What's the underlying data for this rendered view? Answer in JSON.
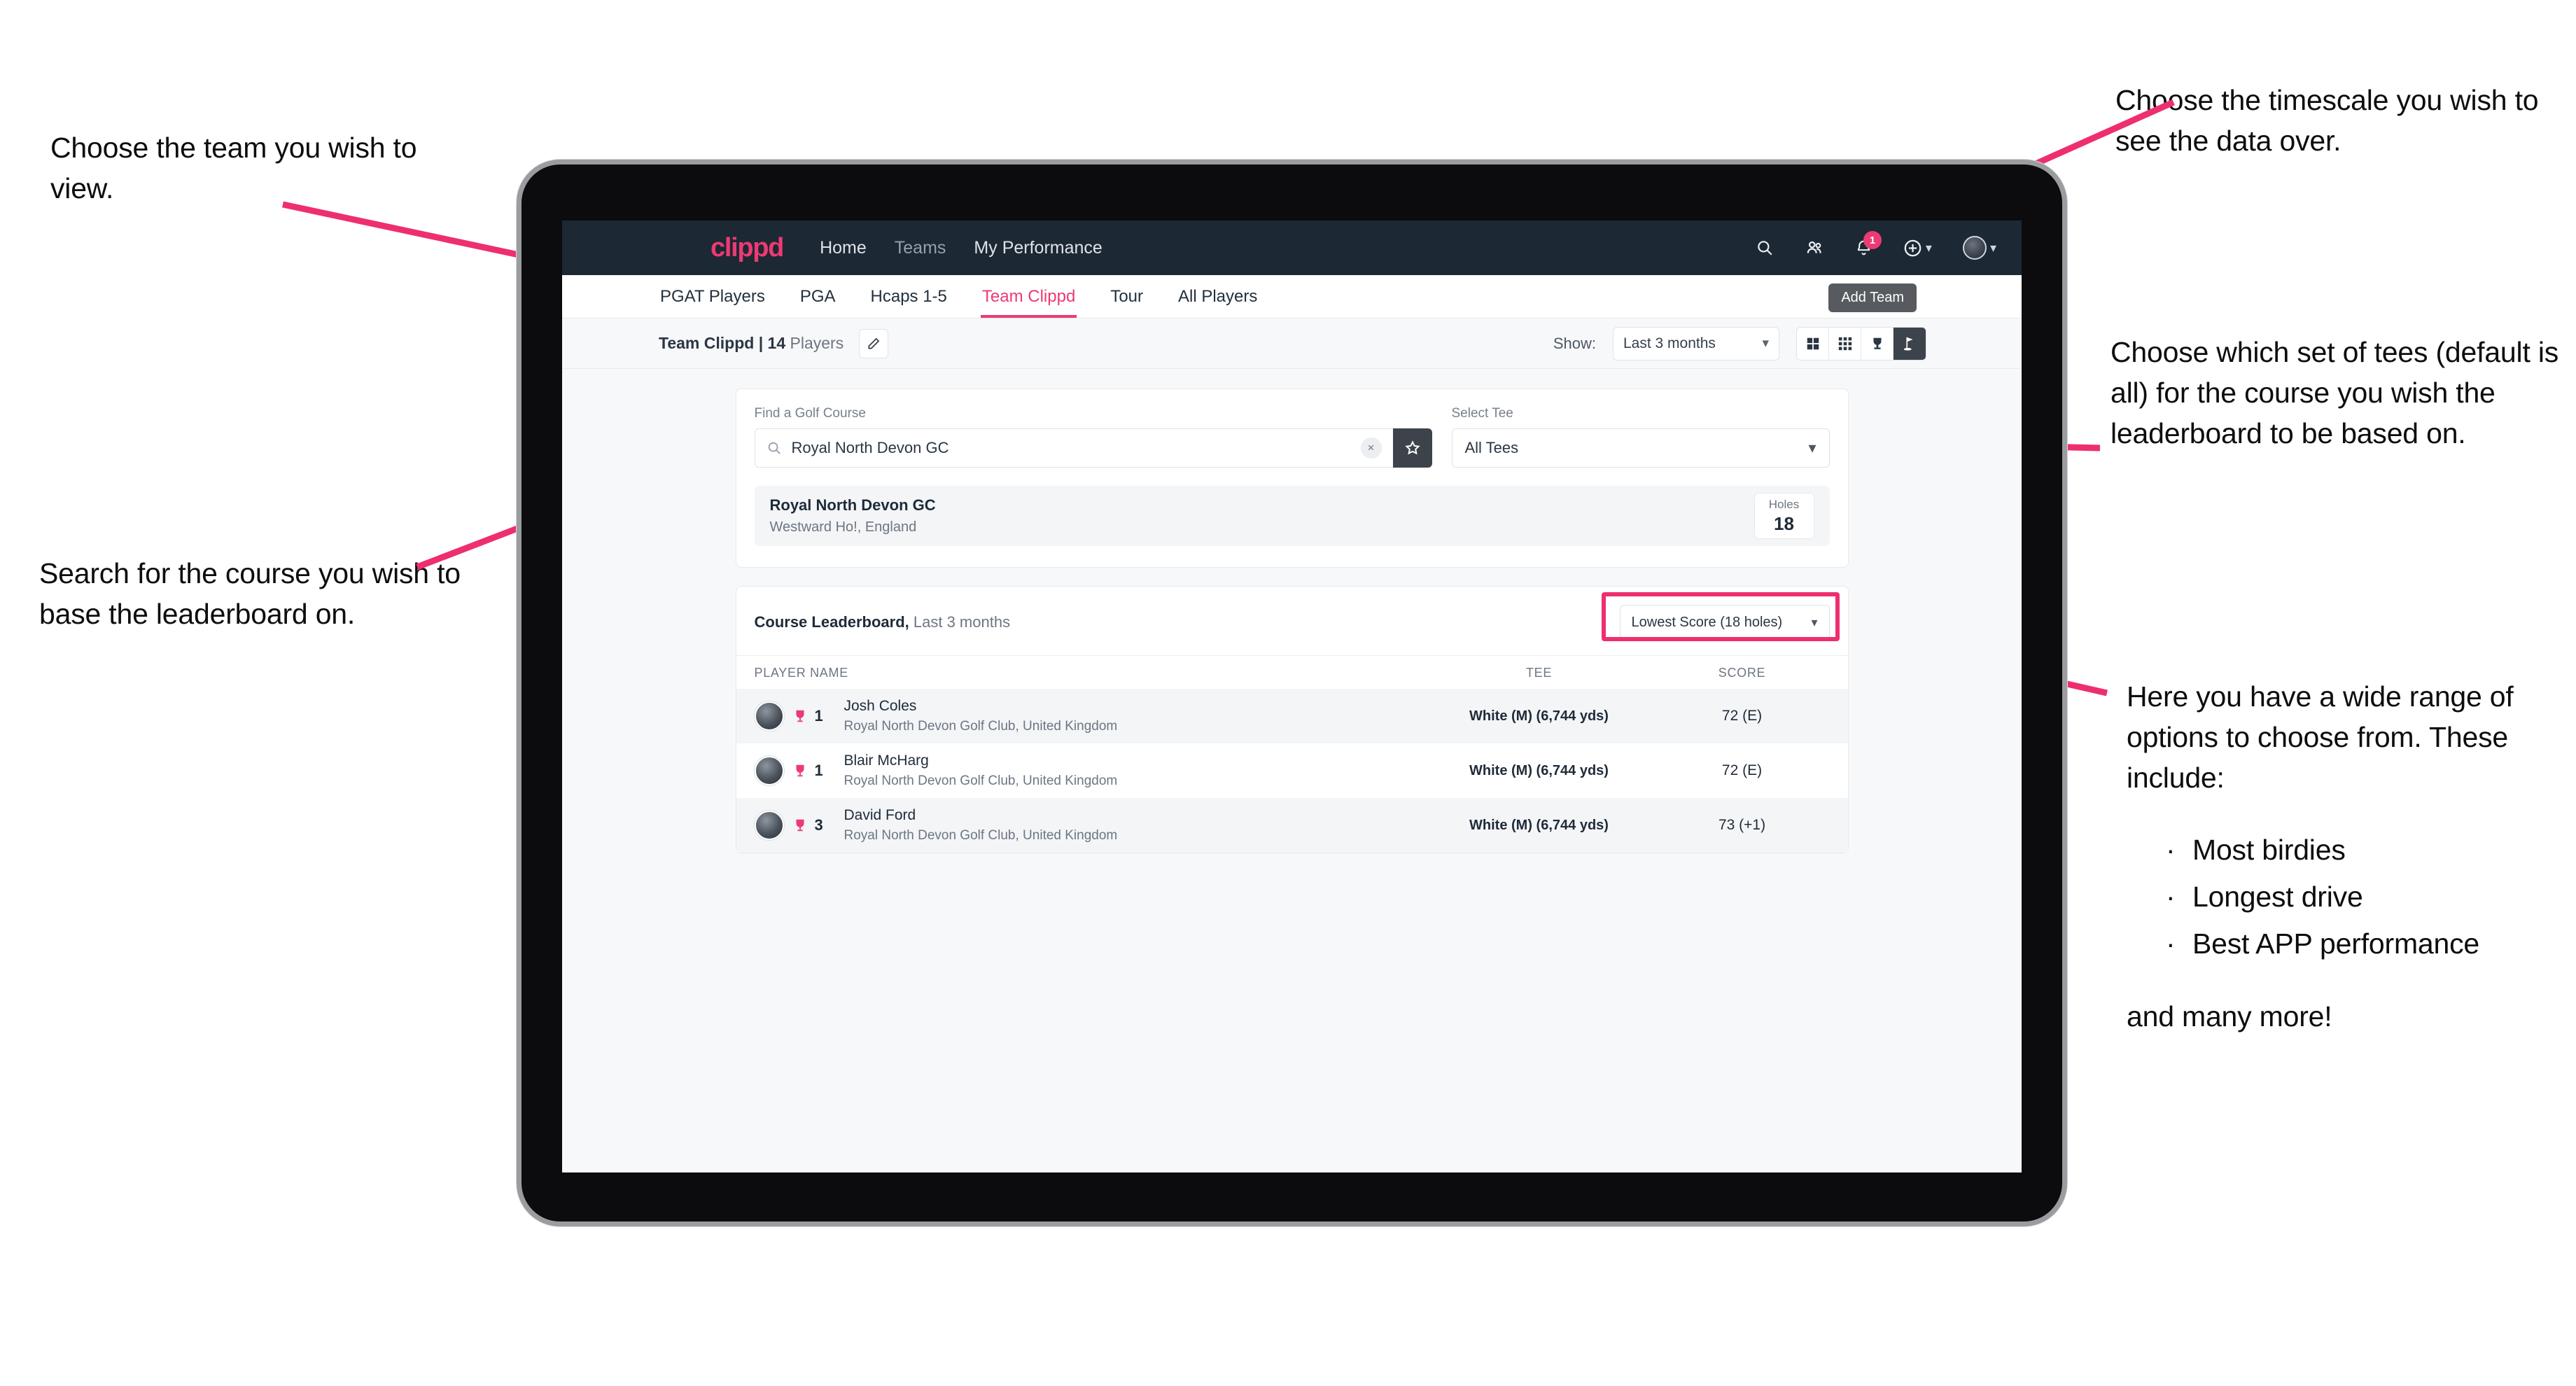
{
  "annotations": {
    "left_top": "Choose the team you wish to view.",
    "left_mid": "Search for the course you wish to base the leaderboard on.",
    "right_top": "Choose the timescale you wish to see the data over.",
    "right_mid": "Choose which set of tees (default is all) for the course you wish the leaderboard to be based on.",
    "right_bottom_intro": "Here you have a wide range of options to choose from. These include:",
    "right_bottom_bullets": [
      "Most birdies",
      "Longest drive",
      "Best APP performance"
    ],
    "right_bottom_tail": "and many more!"
  },
  "colors": {
    "accent": "#ec3a72",
    "highlight": "#ee2f6e",
    "navbar": "#1c2834"
  },
  "topnav": {
    "brand": "clippd",
    "links": [
      {
        "label": "Home",
        "dim": false
      },
      {
        "label": "Teams",
        "dim": true
      },
      {
        "label": "My Performance",
        "dim": false
      }
    ],
    "icons": [
      "search-icon",
      "people-icon",
      "bell-icon",
      "plus-circle-icon",
      "avatar-icon"
    ],
    "notification_count": "1"
  },
  "tabs": {
    "items": [
      {
        "label": "PGAT Players",
        "state": "normal"
      },
      {
        "label": "PGA",
        "state": "normal"
      },
      {
        "label": "Hcaps 1-5",
        "state": "normal"
      },
      {
        "label": "Team Clippd",
        "state": "active"
      },
      {
        "label": "Tour",
        "state": "normal"
      },
      {
        "label": "All Players",
        "state": "normal"
      }
    ],
    "tooltip": "Add Team"
  },
  "teambar": {
    "team_name": "Team Clippd",
    "separator": "|",
    "player_count": "14",
    "players_word": "Players",
    "edit_icon": "pencil-icon",
    "show_label": "Show:",
    "timescale_value": "Last 3 months",
    "view_buttons": [
      "grid-large-icon",
      "grid-small-icon",
      "trophy-icon",
      "flag-icon"
    ],
    "view_selected_index": 3
  },
  "search": {
    "course_label": "Find a Golf Course",
    "course_value": "Royal North Devon GC",
    "course_placeholder": "Find a Golf Course",
    "clear_label": "×",
    "star_icon": "star-icon",
    "tee_label": "Select Tee",
    "tee_value": "All Tees"
  },
  "course": {
    "name": "Royal North Devon GC",
    "location": "Westward Ho!, England",
    "holes_label": "Holes",
    "holes_value": "18"
  },
  "leaderboard": {
    "title": "Course Leaderboard,",
    "subtitle": " Last 3 months",
    "metric_value": "Lowest Score (18 holes)",
    "columns": {
      "name": "PLAYER NAME",
      "tee": "TEE",
      "score": "SCORE"
    },
    "rows": [
      {
        "rank": "1",
        "name": "Josh Coles",
        "club": "Royal North Devon Golf Club, United Kingdom",
        "tee": "White (M) (6,744 yds)",
        "score": "72 (E)"
      },
      {
        "rank": "1",
        "name": "Blair McHarg",
        "club": "Royal North Devon Golf Club, United Kingdom",
        "tee": "White (M) (6,744 yds)",
        "score": "72 (E)"
      },
      {
        "rank": "3",
        "name": "David Ford",
        "club": "Royal North Devon Golf Club, United Kingdom",
        "tee": "White (M) (6,744 yds)",
        "score": "73 (+1)"
      }
    ]
  }
}
